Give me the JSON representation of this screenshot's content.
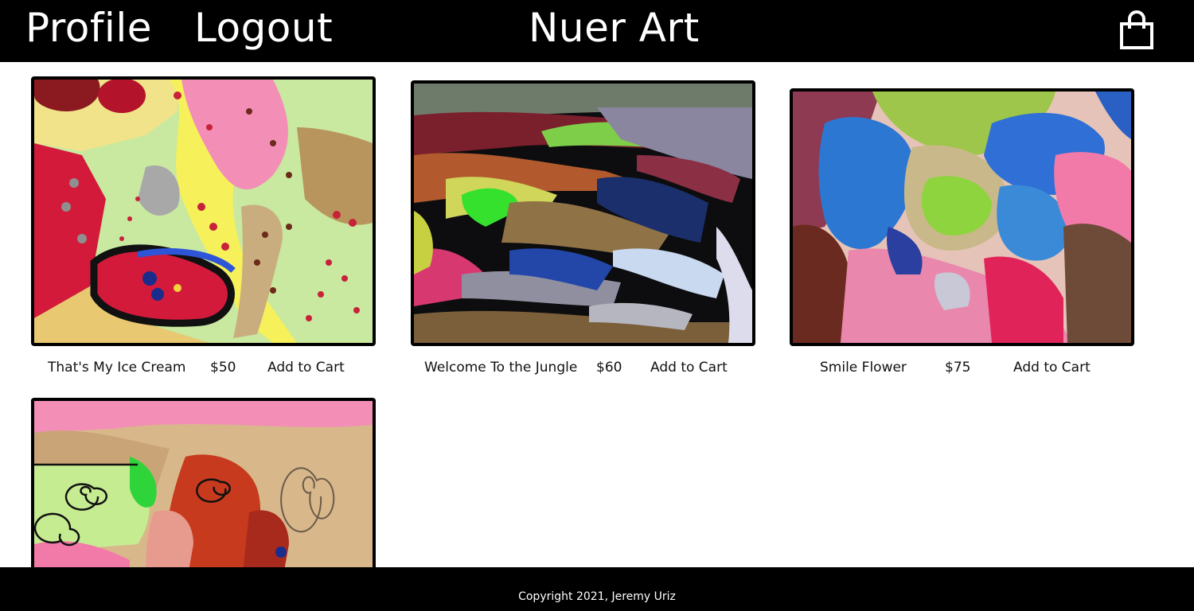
{
  "header": {
    "profile_label": "Profile",
    "logout_label": "Logout",
    "brand": "Nuer Art",
    "cart_icon": "shopping-bag-icon"
  },
  "products": [
    {
      "title": "That's My Ice Cream",
      "price": "$50",
      "action": "Add to Cart"
    },
    {
      "title": "Welcome To the Jungle",
      "price": "$60",
      "action": "Add to Cart"
    },
    {
      "title": "Smile Flower",
      "price": "$75",
      "action": "Add to Cart"
    },
    {
      "title": "",
      "price": "",
      "action": ""
    }
  ],
  "footer": {
    "copyright": "Copyright 2021, Jeremy Uriz"
  },
  "colors": {
    "header_bg": "#000000",
    "footer_bg": "#000000",
    "text_light": "#ffffff",
    "text_dark": "#111111"
  }
}
